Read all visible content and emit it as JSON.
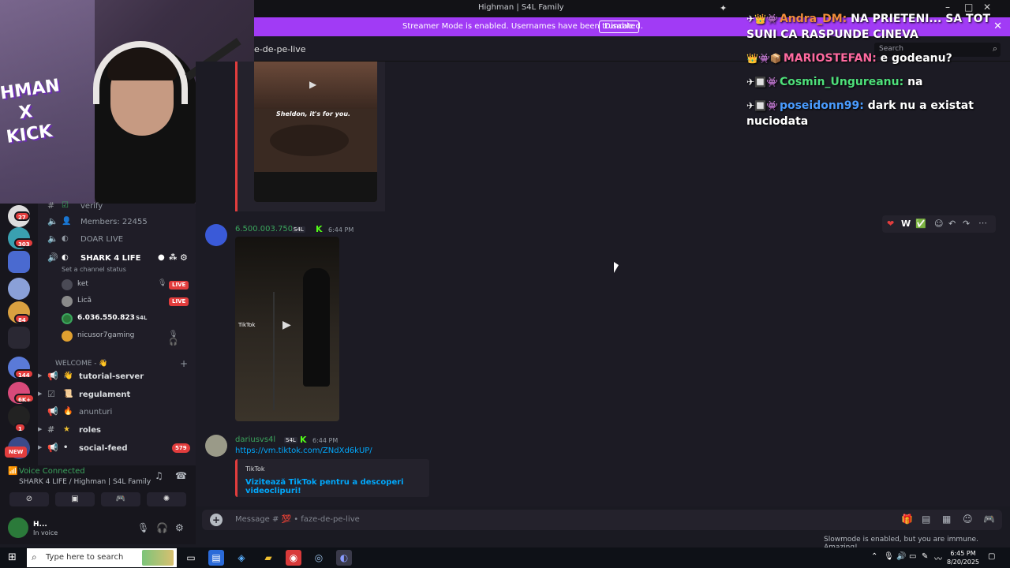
{
  "window": {
    "title": "Highman | S4L Family"
  },
  "banner": {
    "text": "Streamer Mode is enabled. Usernames have been truncated.",
    "disable_label": "Disable",
    "color": "#a13bf5"
  },
  "channel_header": {
    "name": "e-de-pe-live",
    "search_placeholder": "Search"
  },
  "webcam": {
    "overlay_text_1": "HMAN",
    "overlay_text_2": "X",
    "overlay_text_3": "KICK"
  },
  "servers": [
    {
      "badge": "27"
    },
    {
      "badge": "303"
    },
    {
      "badge": ""
    },
    {
      "badge": ""
    },
    {
      "badge": "84"
    },
    {
      "badge": ""
    },
    {
      "badge": "144"
    },
    {
      "badge": "6K+"
    },
    {
      "badge": "1"
    }
  ],
  "new_badge": "NEW",
  "sidebar": {
    "channels": [
      {
        "label": "verify"
      },
      {
        "label": "Members: 22455"
      },
      {
        "label": "DOAR LIVE"
      },
      {
        "label": "SHARK 4 LIFE",
        "status": "Set a channel status"
      }
    ],
    "voice_users": [
      {
        "name": "ket",
        "live": "LIVE"
      },
      {
        "name": "Lică",
        "live": "LIVE"
      },
      {
        "name": "6.036.550.823",
        "tag": "S4L"
      },
      {
        "name": "nicusor7gaming"
      }
    ],
    "category": "WELCOME - 👋",
    "text_channels": [
      {
        "label": "tutorial-server"
      },
      {
        "label": "regulament"
      },
      {
        "label": "anunturi"
      },
      {
        "label": "roles"
      },
      {
        "label": "social-feed",
        "badge": "579"
      }
    ]
  },
  "voice_panel": {
    "status": "Voice Connected",
    "sub": "SHARK 4 LIFE / Highman | S4L Family",
    "user_name": "H...",
    "user_sub": "In voice"
  },
  "chat": {
    "embed_caption": "Sheldon, it's for you.",
    "message_1": {
      "author": "6.500.003.750",
      "tag": "S4L",
      "time": "6:44 PM"
    },
    "message_2": {
      "author": "dariusvs4l",
      "tag": "S4L",
      "time": "6:44 PM",
      "link": "https://vm.tiktok.com/ZNdXd6kUP/",
      "embed_provider": "TikTok",
      "embed_title": "Vizitează TikTok pentru a descoperi videoclipuri!"
    },
    "tiktok_watermark": "TikTok",
    "actions": [
      "❤",
      "W",
      "✅"
    ],
    "composer_placeholder": "Message # 💯 • faze-de-pe-live",
    "slowmode": "Slowmode is enabled, but you are immune. Amazing!"
  },
  "overlay_chat": [
    {
      "badges": "✈👑👾",
      "user": "Andra_DM:",
      "text": " NA PRIETENI... SA TOT SUNI CA RASPUNDE CINEVA",
      "color": "#f08c3a"
    },
    {
      "badges": "👑👾📦",
      "user": "MARIOSTEFAN:",
      "text": " e godeanu?",
      "color": "#ff6aa0"
    },
    {
      "badges": "✈🔲👾",
      "user": "Cosmin_Ungureanu:",
      "text": " na",
      "color": "#4ee07a"
    },
    {
      "badges": "✈🔲👾",
      "user": "poseidonn99:",
      "text": " dark nu a existat nuciodata",
      "color": "#4a9cff"
    }
  ],
  "taskbar": {
    "search_placeholder": "Type here to search",
    "time": "6:45 PM",
    "date": "8/20/2025"
  }
}
